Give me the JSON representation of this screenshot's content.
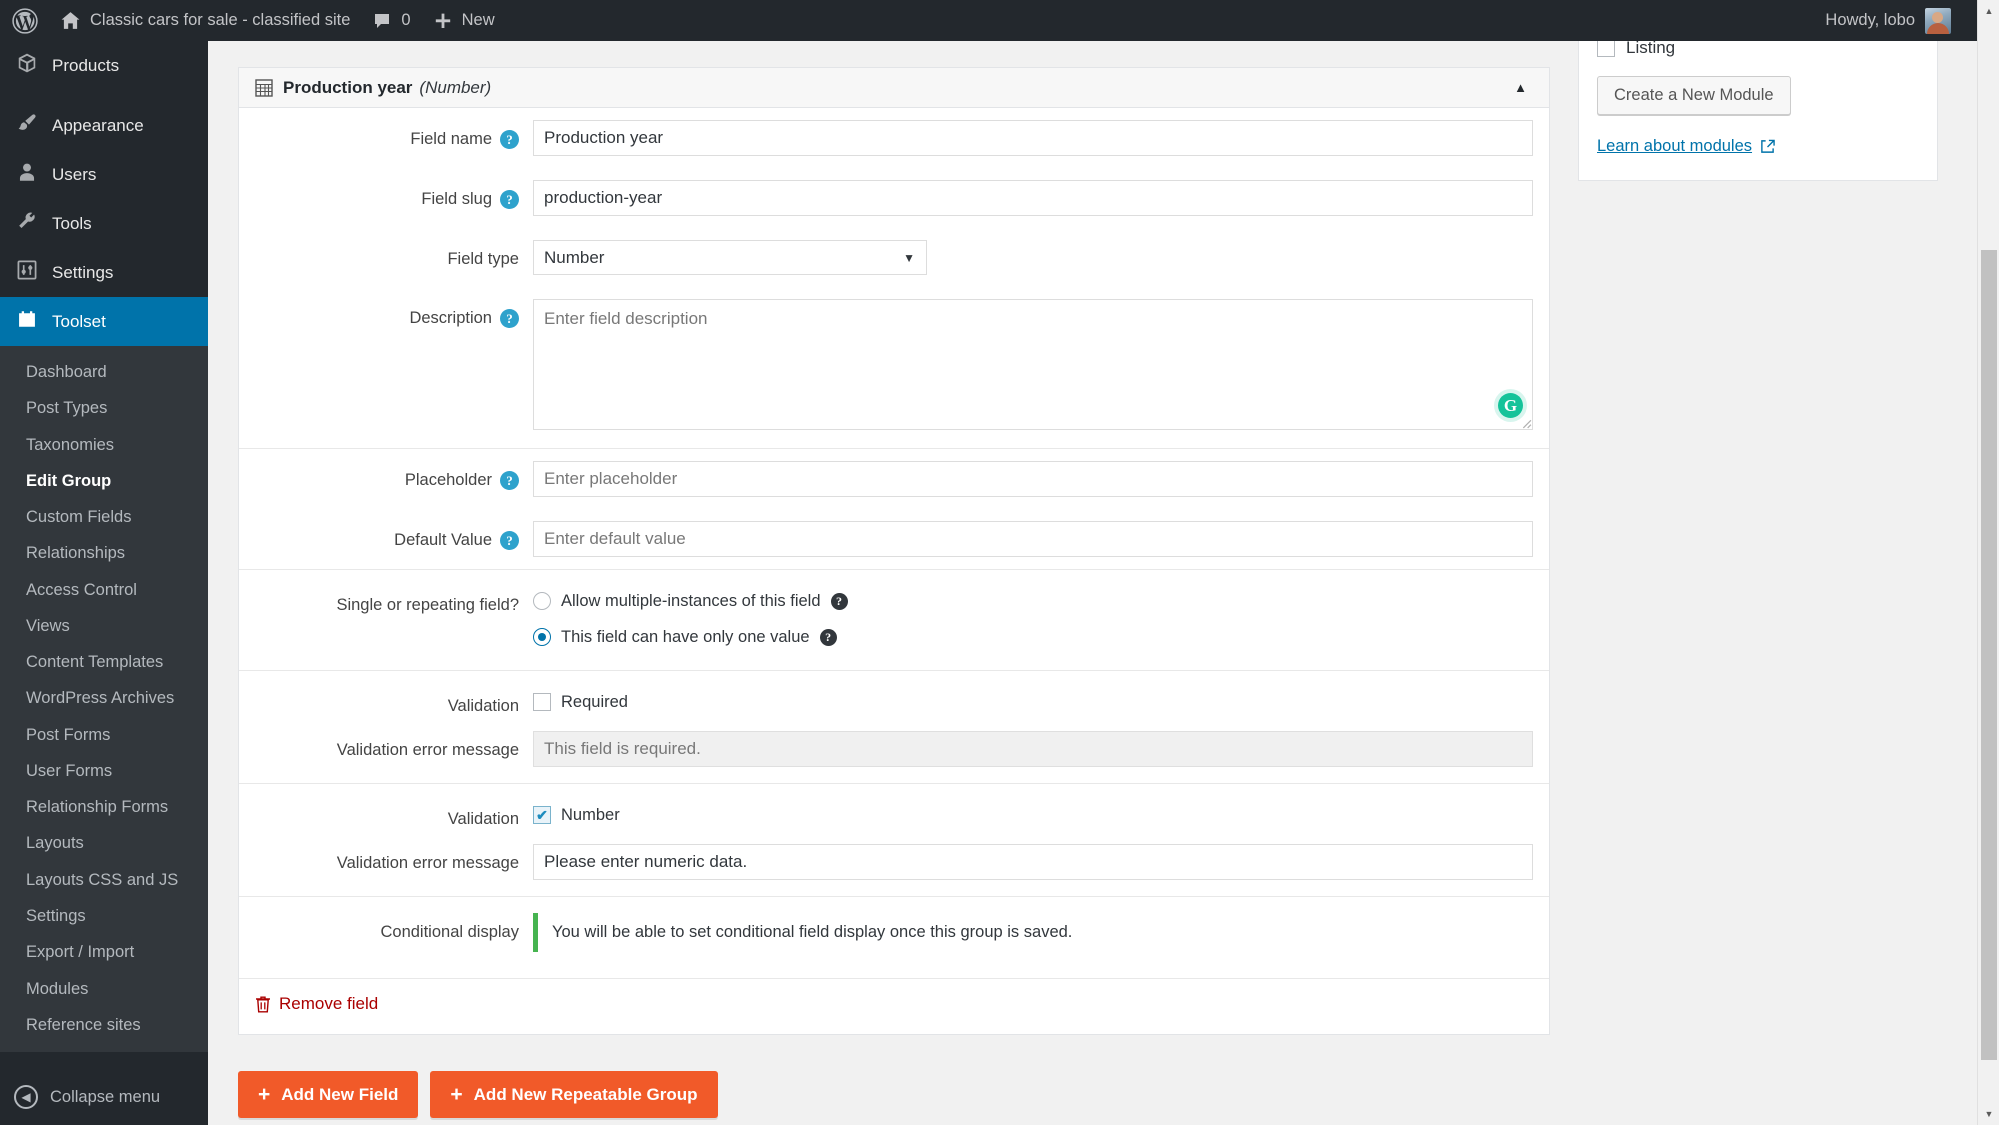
{
  "adminbar": {
    "logo_icon": "wordpress-logo-icon",
    "home_icon": "home-icon",
    "site_title": "Classic cars for sale - classified site",
    "comments_icon": "comment-bubble-icon",
    "comments_count": "0",
    "new_icon": "plus-icon",
    "new_label": "New",
    "howdy": "Howdy, lobo",
    "avatar_name": "user-avatar"
  },
  "sidebar": {
    "top_items": [
      {
        "label": "Products",
        "icon": "products-box-icon",
        "active": false
      },
      {
        "label": "Appearance",
        "icon": "paintbrush-icon",
        "active": false
      },
      {
        "label": "Users",
        "icon": "user-icon",
        "active": false
      },
      {
        "label": "Tools",
        "icon": "wrench-icon",
        "active": false
      },
      {
        "label": "Settings",
        "icon": "settings-sliders-icon",
        "active": false
      },
      {
        "label": "Toolset",
        "icon": "toolset-icon",
        "active": true
      }
    ],
    "submenu": [
      {
        "label": "Dashboard",
        "current": false
      },
      {
        "label": "Post Types",
        "current": false
      },
      {
        "label": "Taxonomies",
        "current": false
      },
      {
        "label": "Edit Group",
        "current": true
      },
      {
        "label": "Custom Fields",
        "current": false
      },
      {
        "label": "Relationships",
        "current": false
      },
      {
        "label": "Access Control",
        "current": false
      },
      {
        "label": "Views",
        "current": false
      },
      {
        "label": "Content Templates",
        "current": false
      },
      {
        "label": "WordPress Archives",
        "current": false
      },
      {
        "label": "Post Forms",
        "current": false
      },
      {
        "label": "User Forms",
        "current": false
      },
      {
        "label": "Relationship Forms",
        "current": false
      },
      {
        "label": "Layouts",
        "current": false
      },
      {
        "label": "Layouts CSS and JS",
        "current": false
      },
      {
        "label": "Settings",
        "current": false
      },
      {
        "label": "Export / Import",
        "current": false
      },
      {
        "label": "Modules",
        "current": false
      },
      {
        "label": "Reference sites",
        "current": false
      }
    ],
    "collapse_label": "Collapse menu",
    "collapse_icon": "chevron-left-circle-icon"
  },
  "panel": {
    "icon": "number-field-grid-icon",
    "title": "Production year",
    "type_suffix": "(Number)",
    "toggle_icon": "chevron-up-icon",
    "fields": {
      "field_name": {
        "label": "Field name",
        "value": "Production year",
        "help_icon": "help-icon"
      },
      "field_slug": {
        "label": "Field slug",
        "value": "production-year",
        "help_icon": "help-icon"
      },
      "field_type": {
        "label": "Field type",
        "value": "Number",
        "options": [
          "Number"
        ],
        "caret_icon": "chevron-down-icon"
      },
      "description": {
        "label": "Description",
        "value": "",
        "placeholder": "Enter field description",
        "help_icon": "help-icon",
        "grammarly_icon": "grammarly-icon",
        "grammarly_glyph": "G"
      },
      "placeholder": {
        "label": "Placeholder",
        "value": "",
        "placeholder": "Enter placeholder",
        "help_icon": "help-icon"
      },
      "default_value": {
        "label": "Default Value",
        "value": "",
        "placeholder": "Enter default value",
        "help_icon": "help-icon"
      },
      "repeating": {
        "label": "Single or repeating field?",
        "options": [
          {
            "label": "Allow multiple-instances of this field",
            "selected": false,
            "help_icon": "help-icon-dark"
          },
          {
            "label": "This field can have only one value",
            "selected": true,
            "help_icon": "help-icon-dark"
          }
        ]
      },
      "validation_required": {
        "label": "Validation",
        "checkbox_label": "Required",
        "checked": false,
        "message_label": "Validation error message",
        "message_value": "",
        "message_placeholder": "This field is required.",
        "message_disabled": true
      },
      "validation_number": {
        "label": "Validation",
        "checkbox_label": "Number",
        "checked": true,
        "check_glyph": "✔",
        "message_label": "Validation error message",
        "message_value": "Please enter numeric data."
      },
      "conditional_display": {
        "label": "Conditional display",
        "notice": "You will be able to set conditional field display once this group is saved."
      }
    },
    "remove_field": {
      "label": "Remove field",
      "icon": "trash-icon"
    }
  },
  "buttons": {
    "add_new_field": {
      "label": "Add New Field",
      "icon": "plus-icon"
    },
    "add_new_repeatable_group": {
      "label": "Add New Repeatable Group",
      "icon": "plus-icon"
    }
  },
  "sidebox": {
    "listing_label": "Listing",
    "listing_checked": false,
    "create_module_label": "Create a New Module",
    "learn_link_label": "Learn about modules",
    "external_icon": "external-link-icon"
  },
  "scrollbar": {
    "up_icon": "scroll-up-arrow-icon",
    "down_icon": "scroll-down-arrow-icon",
    "thumb_name": "scrollbar-thumb"
  },
  "colors": {
    "admin_dark": "#23282d",
    "submenu_dark": "#32373c",
    "wp_blue": "#0073aa",
    "help_blue": "#2ea2cc",
    "orange": "#f15a29",
    "green_notice": "#46b450",
    "grammarly_green": "#15c39a",
    "remove_red": "#a00000"
  }
}
